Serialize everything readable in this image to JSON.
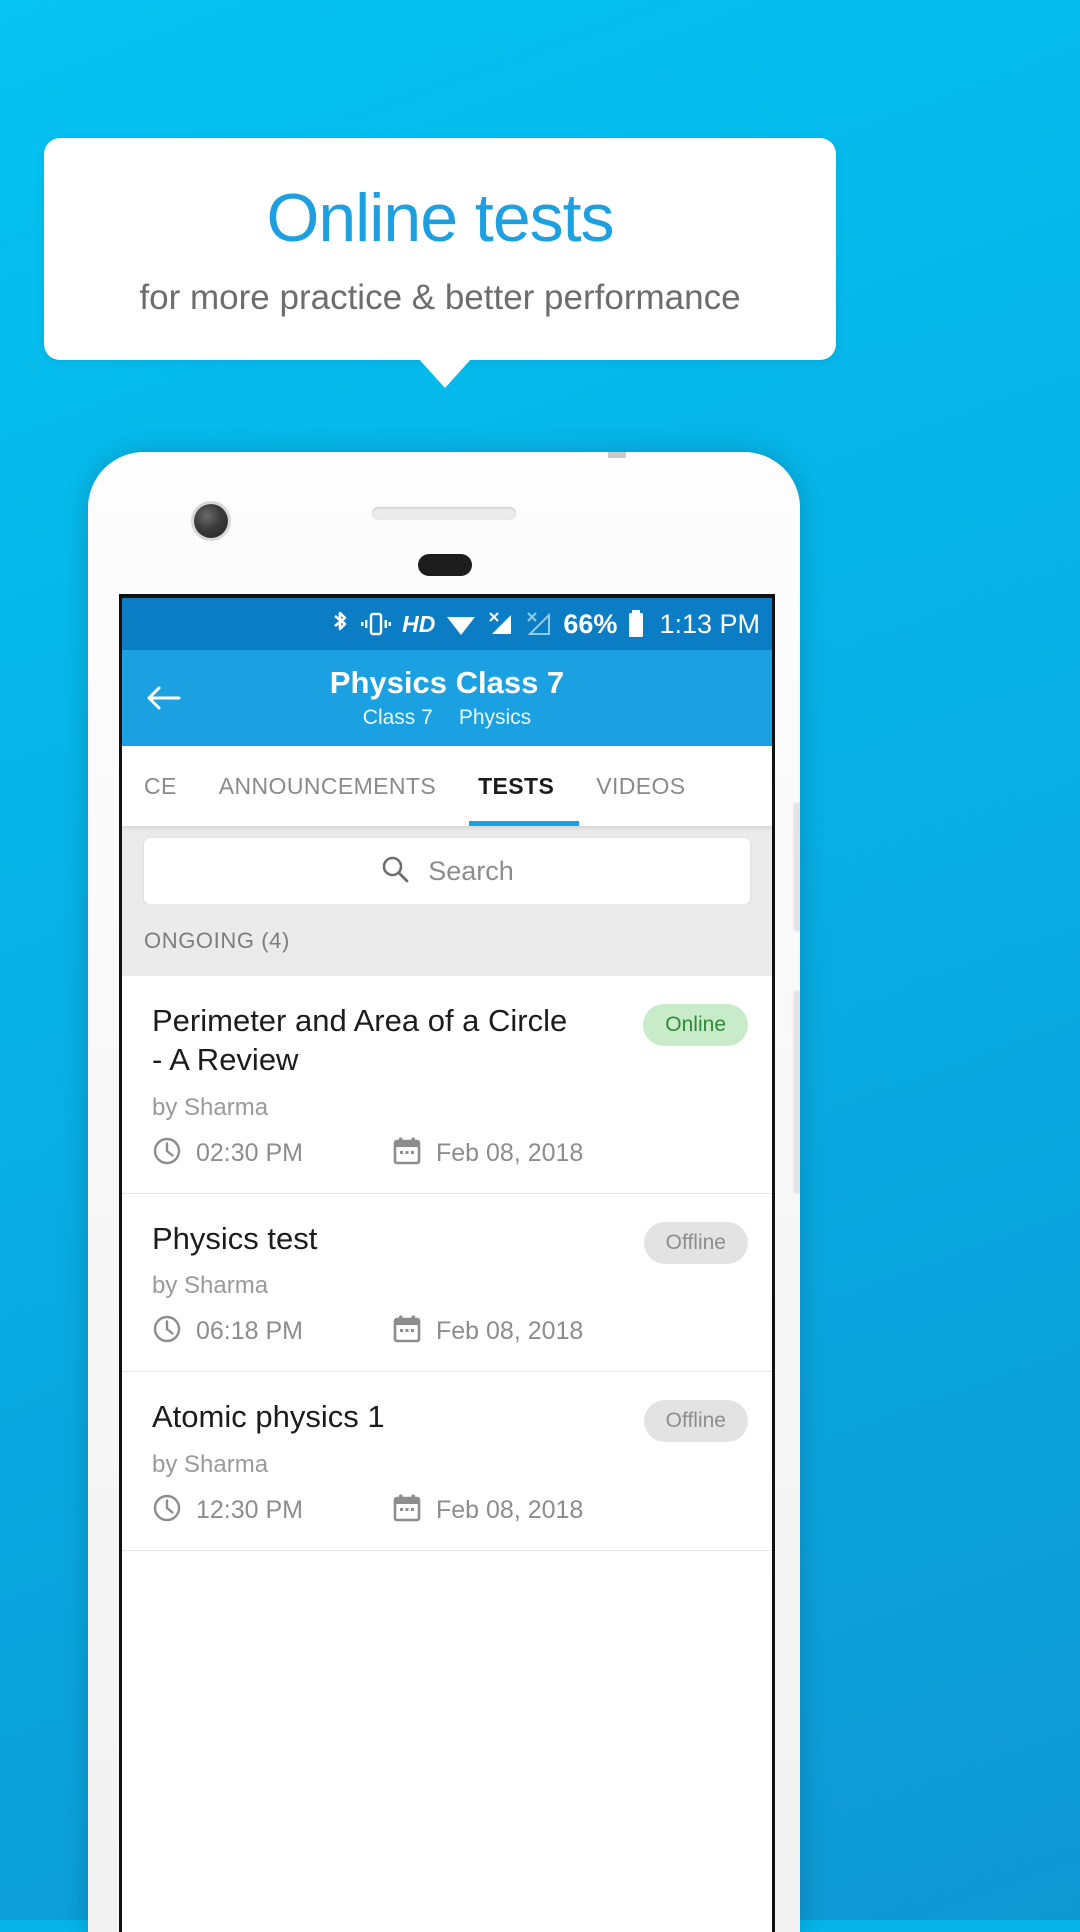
{
  "promo": {
    "title": "Online tests",
    "subtitle": "for more practice & better performance"
  },
  "colors": {
    "background": "#06b4ea",
    "accent": "#1ba1e2",
    "appbar": "#1ba1e2",
    "statusbar": "#0b7dc4",
    "badge_online_bg": "#c8ebca",
    "badge_online_text": "#2e8b37",
    "badge_offline_bg": "#e3e3e3",
    "badge_offline_text": "#8d8d8d"
  },
  "statusbar": {
    "icons": [
      "bluetooth-icon",
      "vibrate-icon",
      "hd-icon",
      "wifi-icon",
      "signal-1-icon",
      "signal-2-icon"
    ],
    "hd_label": "HD",
    "battery_percent": "66%",
    "time": "1:13 PM"
  },
  "appbar": {
    "back_label": "back-arrow",
    "title": "Physics Class 7",
    "subtitle_class": "Class 7",
    "subtitle_subject": "Physics"
  },
  "tabs": [
    {
      "label": "CE",
      "active": false
    },
    {
      "label": "ANNOUNCEMENTS",
      "active": false
    },
    {
      "label": "TESTS",
      "active": true
    },
    {
      "label": "VIDEOS",
      "active": false
    }
  ],
  "search": {
    "placeholder": "Search",
    "value": "",
    "icon": "search-icon"
  },
  "section": {
    "heading": "ONGOING (4)"
  },
  "tests": [
    {
      "title": "Perimeter and Area of a Circle - A Review",
      "author": "by Sharma",
      "time": "02:30 PM",
      "date": "Feb 08, 2018",
      "status": "Online",
      "status_kind": "online"
    },
    {
      "title": "Physics test",
      "author": "by Sharma",
      "time": "06:18 PM",
      "date": "Feb 08, 2018",
      "status": "Offline",
      "status_kind": "offline"
    },
    {
      "title": "Atomic physics 1",
      "author": "by Sharma",
      "time": "12:30 PM",
      "date": "Feb 08, 2018",
      "status": "Offline",
      "status_kind": "offline"
    }
  ]
}
